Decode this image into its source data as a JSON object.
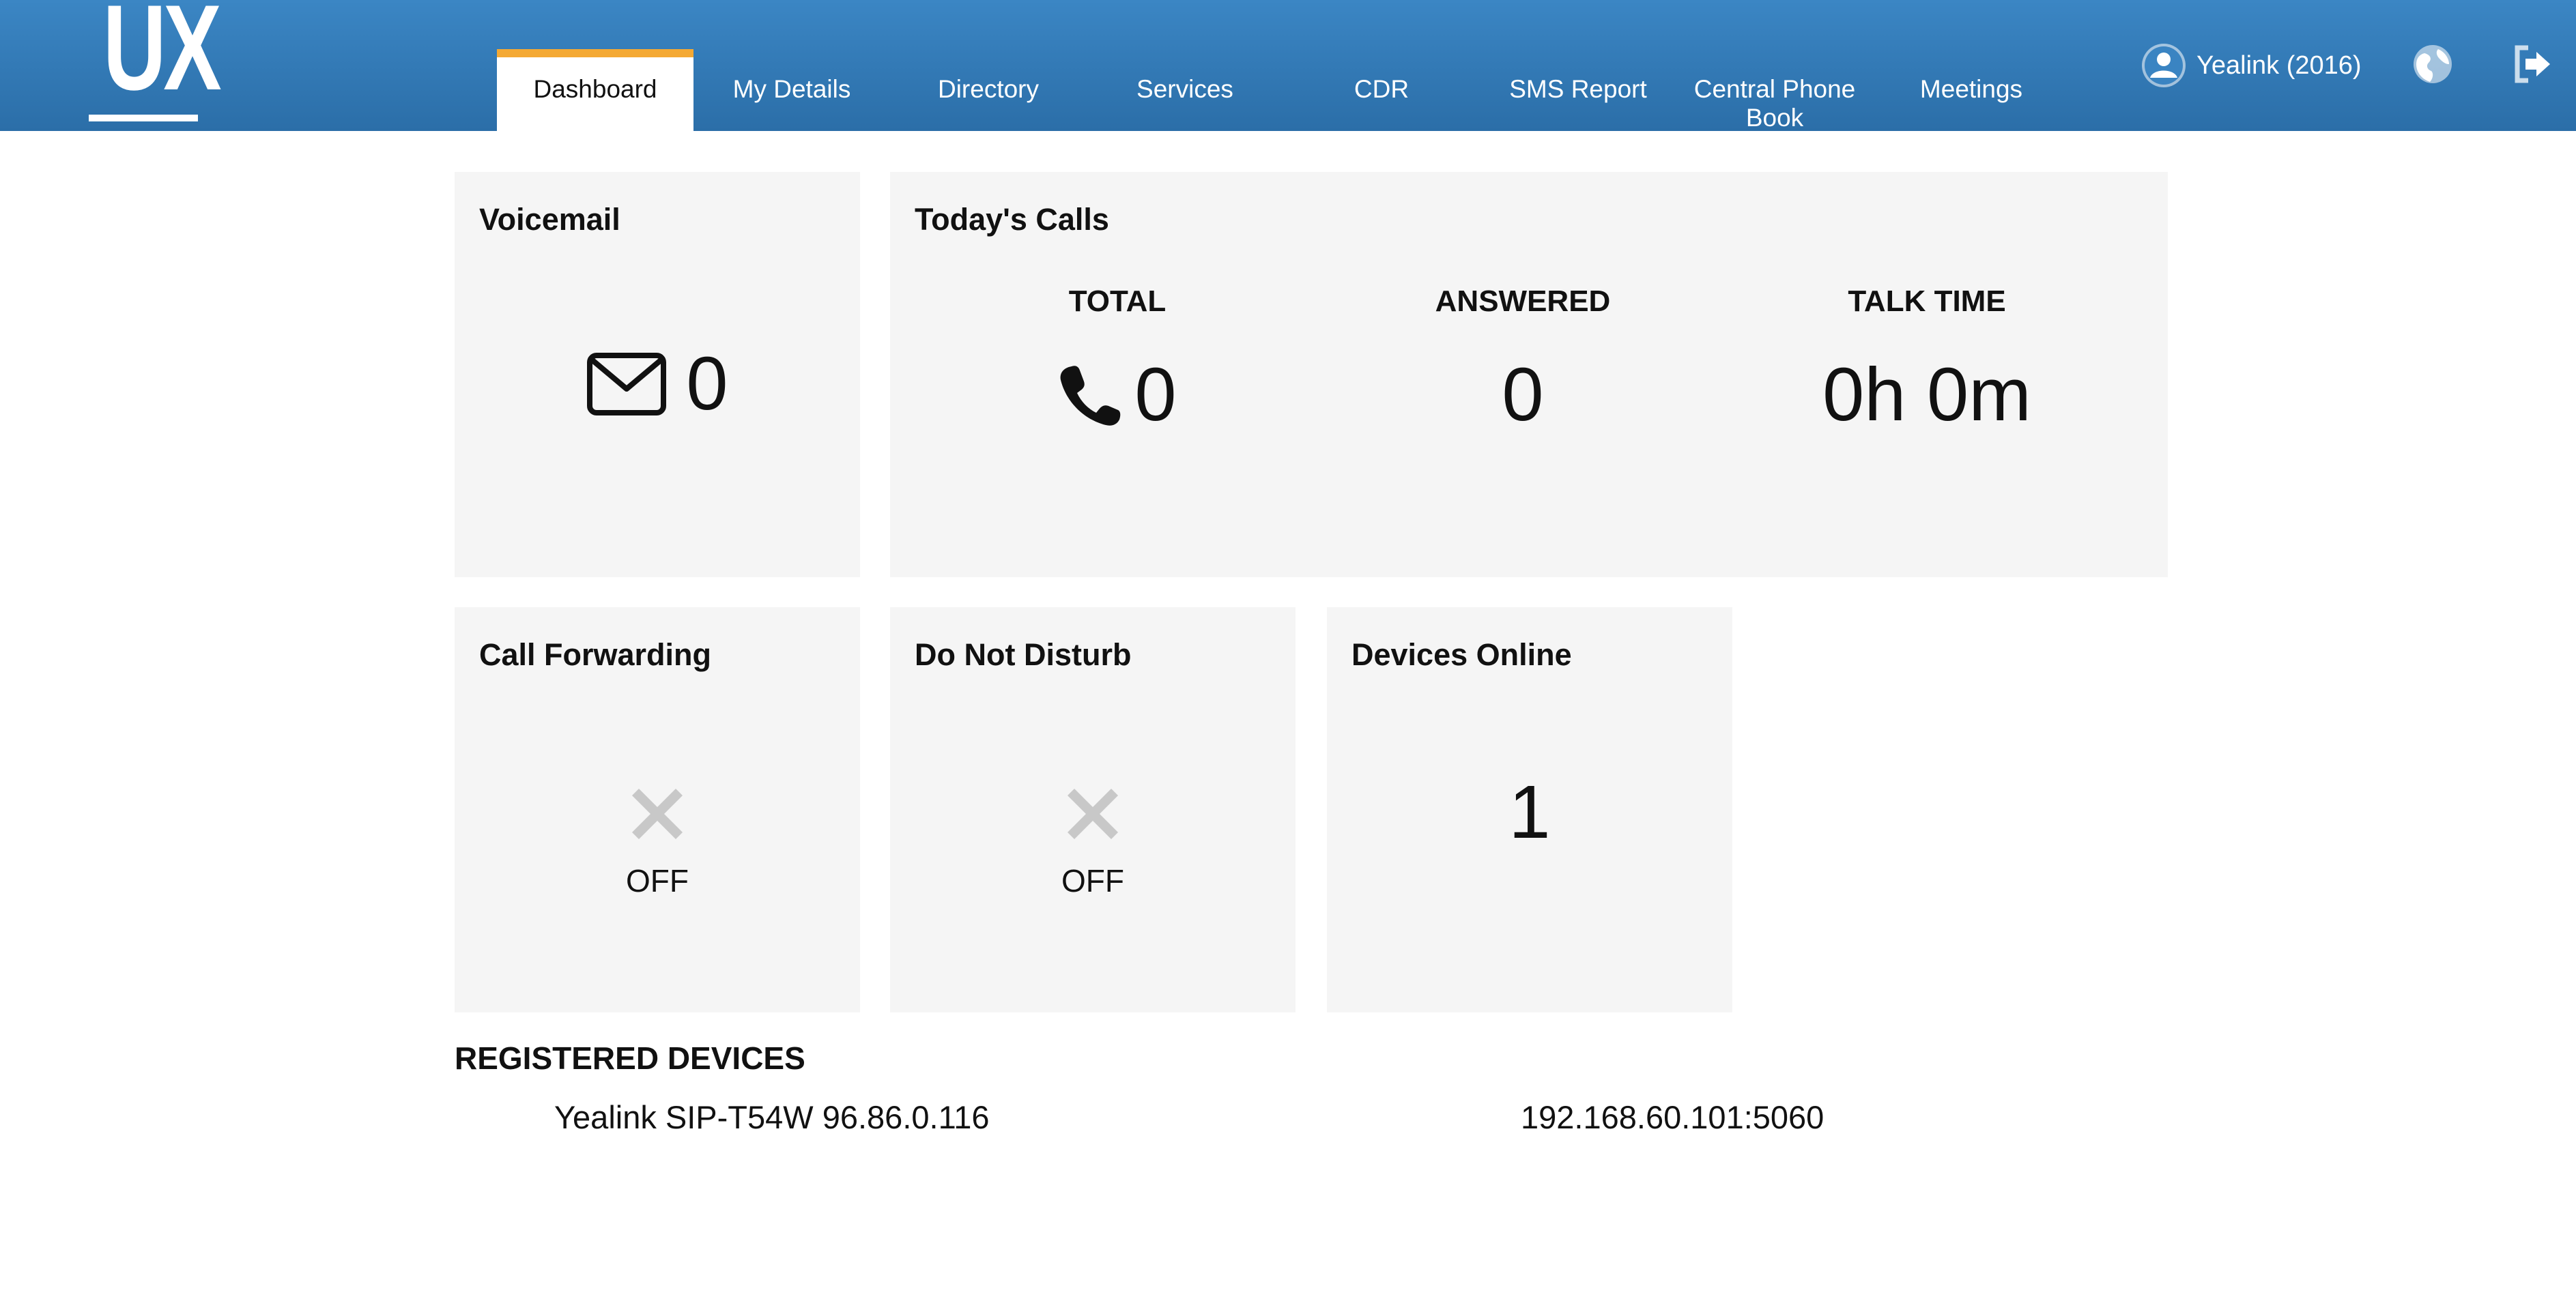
{
  "header": {
    "logo_text": "UX",
    "user_label": "Yealink (2016)",
    "colors": {
      "header_bg": "#2f78b6",
      "active_tab_accent": "#f4a934"
    },
    "tabs": [
      {
        "label": "Dashboard",
        "active": true
      },
      {
        "label": "My Details",
        "active": false
      },
      {
        "label": "Directory",
        "active": false
      },
      {
        "label": "Services",
        "active": false
      },
      {
        "label": "CDR",
        "active": false
      },
      {
        "label": "SMS Report",
        "active": false
      },
      {
        "label": "Central Phone Book",
        "active": false
      },
      {
        "label": "Meetings",
        "active": false
      }
    ],
    "icons": [
      "user-icon",
      "globe-icon",
      "logout-icon"
    ]
  },
  "voicemail": {
    "title": "Voicemail",
    "count": "0",
    "icon": "envelope-icon"
  },
  "todays_calls": {
    "title": "Today's Calls",
    "total_label": "TOTAL",
    "total_value": "0",
    "answered_label": "ANSWERED",
    "answered_value": "0",
    "talk_time_label": "TALK TIME",
    "talk_time_value": "0h 0m",
    "icon": "phone-icon"
  },
  "call_forwarding": {
    "title": "Call Forwarding",
    "status": "OFF",
    "icon": "cross-icon"
  },
  "do_not_disturb": {
    "title": "Do Not Disturb",
    "status": "OFF",
    "icon": "cross-icon"
  },
  "devices_online": {
    "title": "Devices Online",
    "count": "1"
  },
  "registered_devices": {
    "title": "REGISTERED DEVICES",
    "items": [
      {
        "name": "Yealink SIP-T54W 96.86.0.116",
        "address": "192.168.60.101:5060"
      }
    ]
  }
}
